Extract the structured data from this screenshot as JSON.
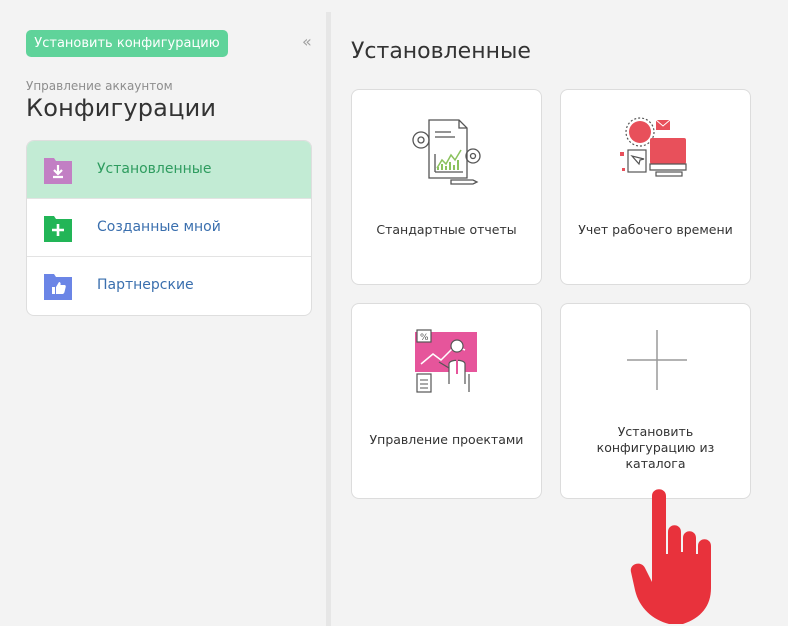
{
  "sidebar": {
    "install_button": "Установить конфигурацию",
    "collapse_glyph": "«",
    "breadcrumb": "Управление аккаунтом",
    "title": "Конфигурации",
    "items": [
      {
        "label": "Установленные",
        "color": "#c27fc4",
        "icon": "download-icon"
      },
      {
        "label": "Созданные мной",
        "color": "#22b557",
        "icon": "plus-icon"
      },
      {
        "label": "Партнерские",
        "color": "#6b85e6",
        "icon": "thumbs-up-icon"
      }
    ]
  },
  "main": {
    "title": "Установленные",
    "cards": [
      {
        "label": "Стандартные отчеты",
        "icon": "reports-illustration"
      },
      {
        "label": "Учет рабочего времени",
        "icon": "time-tracking-illustration"
      },
      {
        "label": "Управление проектами",
        "icon": "project-management-illustration"
      },
      {
        "label": "Установить конфигурацию из каталога",
        "icon": "plus-icon"
      }
    ]
  },
  "colors": {
    "accent_green": "#5fd39a",
    "active_bg": "#c2ebd4",
    "link_blue": "#3a6fae",
    "pointer_red": "#e8323c"
  }
}
